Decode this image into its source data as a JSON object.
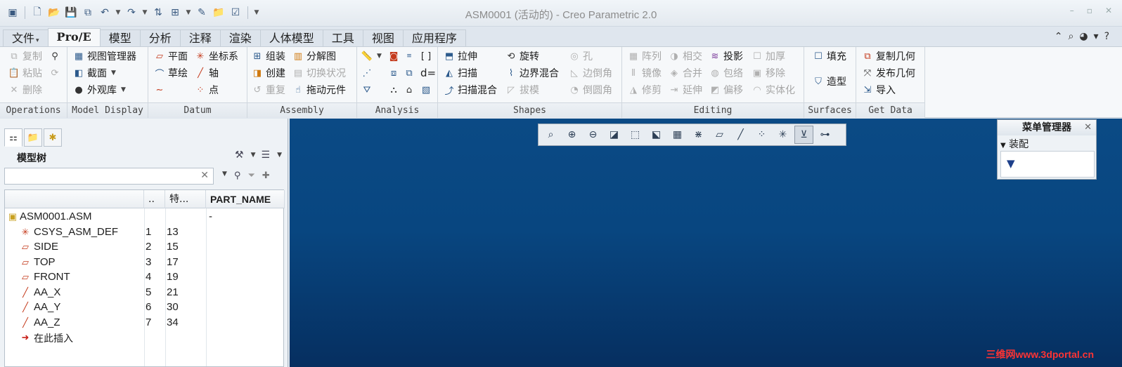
{
  "window": {
    "title": "ASM0001 (活动的) - Creo Parametric 2.0",
    "controls": [
      "–",
      "▫",
      "✕"
    ]
  },
  "quick_access": [
    {
      "icon": "app-icon",
      "glyph": "▣"
    },
    {
      "icon": "new-file-icon",
      "glyph": "🗋"
    },
    {
      "icon": "open-folder-icon",
      "glyph": "📂"
    },
    {
      "icon": "save-icon",
      "glyph": "💾"
    },
    {
      "icon": "save-copy-icon",
      "glyph": "⧉"
    },
    {
      "icon": "undo-icon",
      "glyph": "↶"
    },
    {
      "icon": "redo-icon",
      "glyph": "↷"
    },
    {
      "icon": "regenerate-icon",
      "glyph": "⇅"
    },
    {
      "icon": "windows-icon",
      "glyph": "⊞"
    },
    {
      "icon": "edit-icon",
      "glyph": "✎"
    },
    {
      "icon": "folder-icon",
      "glyph": "📁"
    },
    {
      "icon": "close-window-icon",
      "glyph": "☑"
    }
  ],
  "tabs": [
    "文件",
    "Pro/E",
    "模型",
    "分析",
    "注释",
    "渲染",
    "人体模型",
    "工具",
    "视图",
    "应用程序"
  ],
  "ribbon": {
    "operations": {
      "label": "Operations",
      "copy": "复制",
      "paste": "粘贴",
      "delete": "删除"
    },
    "model_display": {
      "label": "Model Display",
      "view_manager": "视图管理器",
      "section": "截面",
      "appearance": "外观库"
    },
    "datum": {
      "label": "Datum",
      "plane": "平面",
      "csys": "坐标系",
      "sketch": "草绘",
      "axis": "轴",
      "point": "点"
    },
    "assembly": {
      "label": "Assembly",
      "assemble": "组装",
      "exploded": "分解图",
      "create": "创建",
      "toggle_status": "切换状况",
      "repeat": "重复",
      "drag": "拖动元件"
    },
    "analysis": {
      "label": "Analysis",
      "d_label": "d="
    },
    "shapes": {
      "label": "Shapes",
      "extrude": "拉伸",
      "revolve": "旋转",
      "hole": "孔",
      "sweep": "扫描",
      "boundary_blend": "边界混合",
      "edge_round": "边倒角",
      "swept_blend": "扫描混合",
      "draft": "拔模",
      "round": "倒圆角"
    },
    "editing": {
      "label": "Editing",
      "pattern": "阵列",
      "intersect": "相交",
      "project": "投影",
      "thicken": "加厚",
      "mirror": "镜像",
      "merge": "合并",
      "wrap": "包络",
      "remove": "移除",
      "trim": "修剪",
      "extend": "延伸",
      "offset": "偏移",
      "solidify": "实体化"
    },
    "surfaces": {
      "label": "Surfaces",
      "fill": "填充",
      "style": "造型"
    },
    "get_data": {
      "label": "Get Data",
      "copy_geom": "复制几何",
      "publish_geom": "发布几何",
      "import": "导入"
    }
  },
  "model_tree": {
    "title": "模型树",
    "search_value": "",
    "columns": [
      "..",
      "特...",
      "PART_NAME"
    ],
    "rows": [
      {
        "name": "ASM0001.ASM",
        "c1": "",
        "c2": "",
        "c3": "-",
        "icon": "assembly-icon"
      },
      {
        "name": "CSYS_ASM_DEF",
        "c1": "1",
        "c2": "13",
        "c3": "",
        "icon": "csys-icon"
      },
      {
        "name": "SIDE",
        "c1": "2",
        "c2": "15",
        "c3": "",
        "icon": "datum-plane-icon"
      },
      {
        "name": "TOP",
        "c1": "3",
        "c2": "17",
        "c3": "",
        "icon": "datum-plane-icon"
      },
      {
        "name": "FRONT",
        "c1": "4",
        "c2": "19",
        "c3": "",
        "icon": "datum-plane-icon"
      },
      {
        "name": "AA_X",
        "c1": "5",
        "c2": "21",
        "c3": "",
        "icon": "datum-axis-icon"
      },
      {
        "name": "AA_Y",
        "c1": "6",
        "c2": "30",
        "c3": "",
        "icon": "datum-axis-icon"
      },
      {
        "name": "AA_Z",
        "c1": "7",
        "c2": "34",
        "c3": "",
        "icon": "datum-axis-icon"
      },
      {
        "name": "在此插入",
        "c1": "",
        "c2": "",
        "c3": "",
        "icon": "insert-here-icon"
      }
    ]
  },
  "menu_manager": {
    "title": "菜单管理器",
    "section": "装配"
  },
  "watermark": "三维网www.3dportal.cn",
  "colors": {
    "graphics_top": "#0b4a85",
    "graphics_bottom": "#062f60",
    "watermark": "#ff3333"
  }
}
